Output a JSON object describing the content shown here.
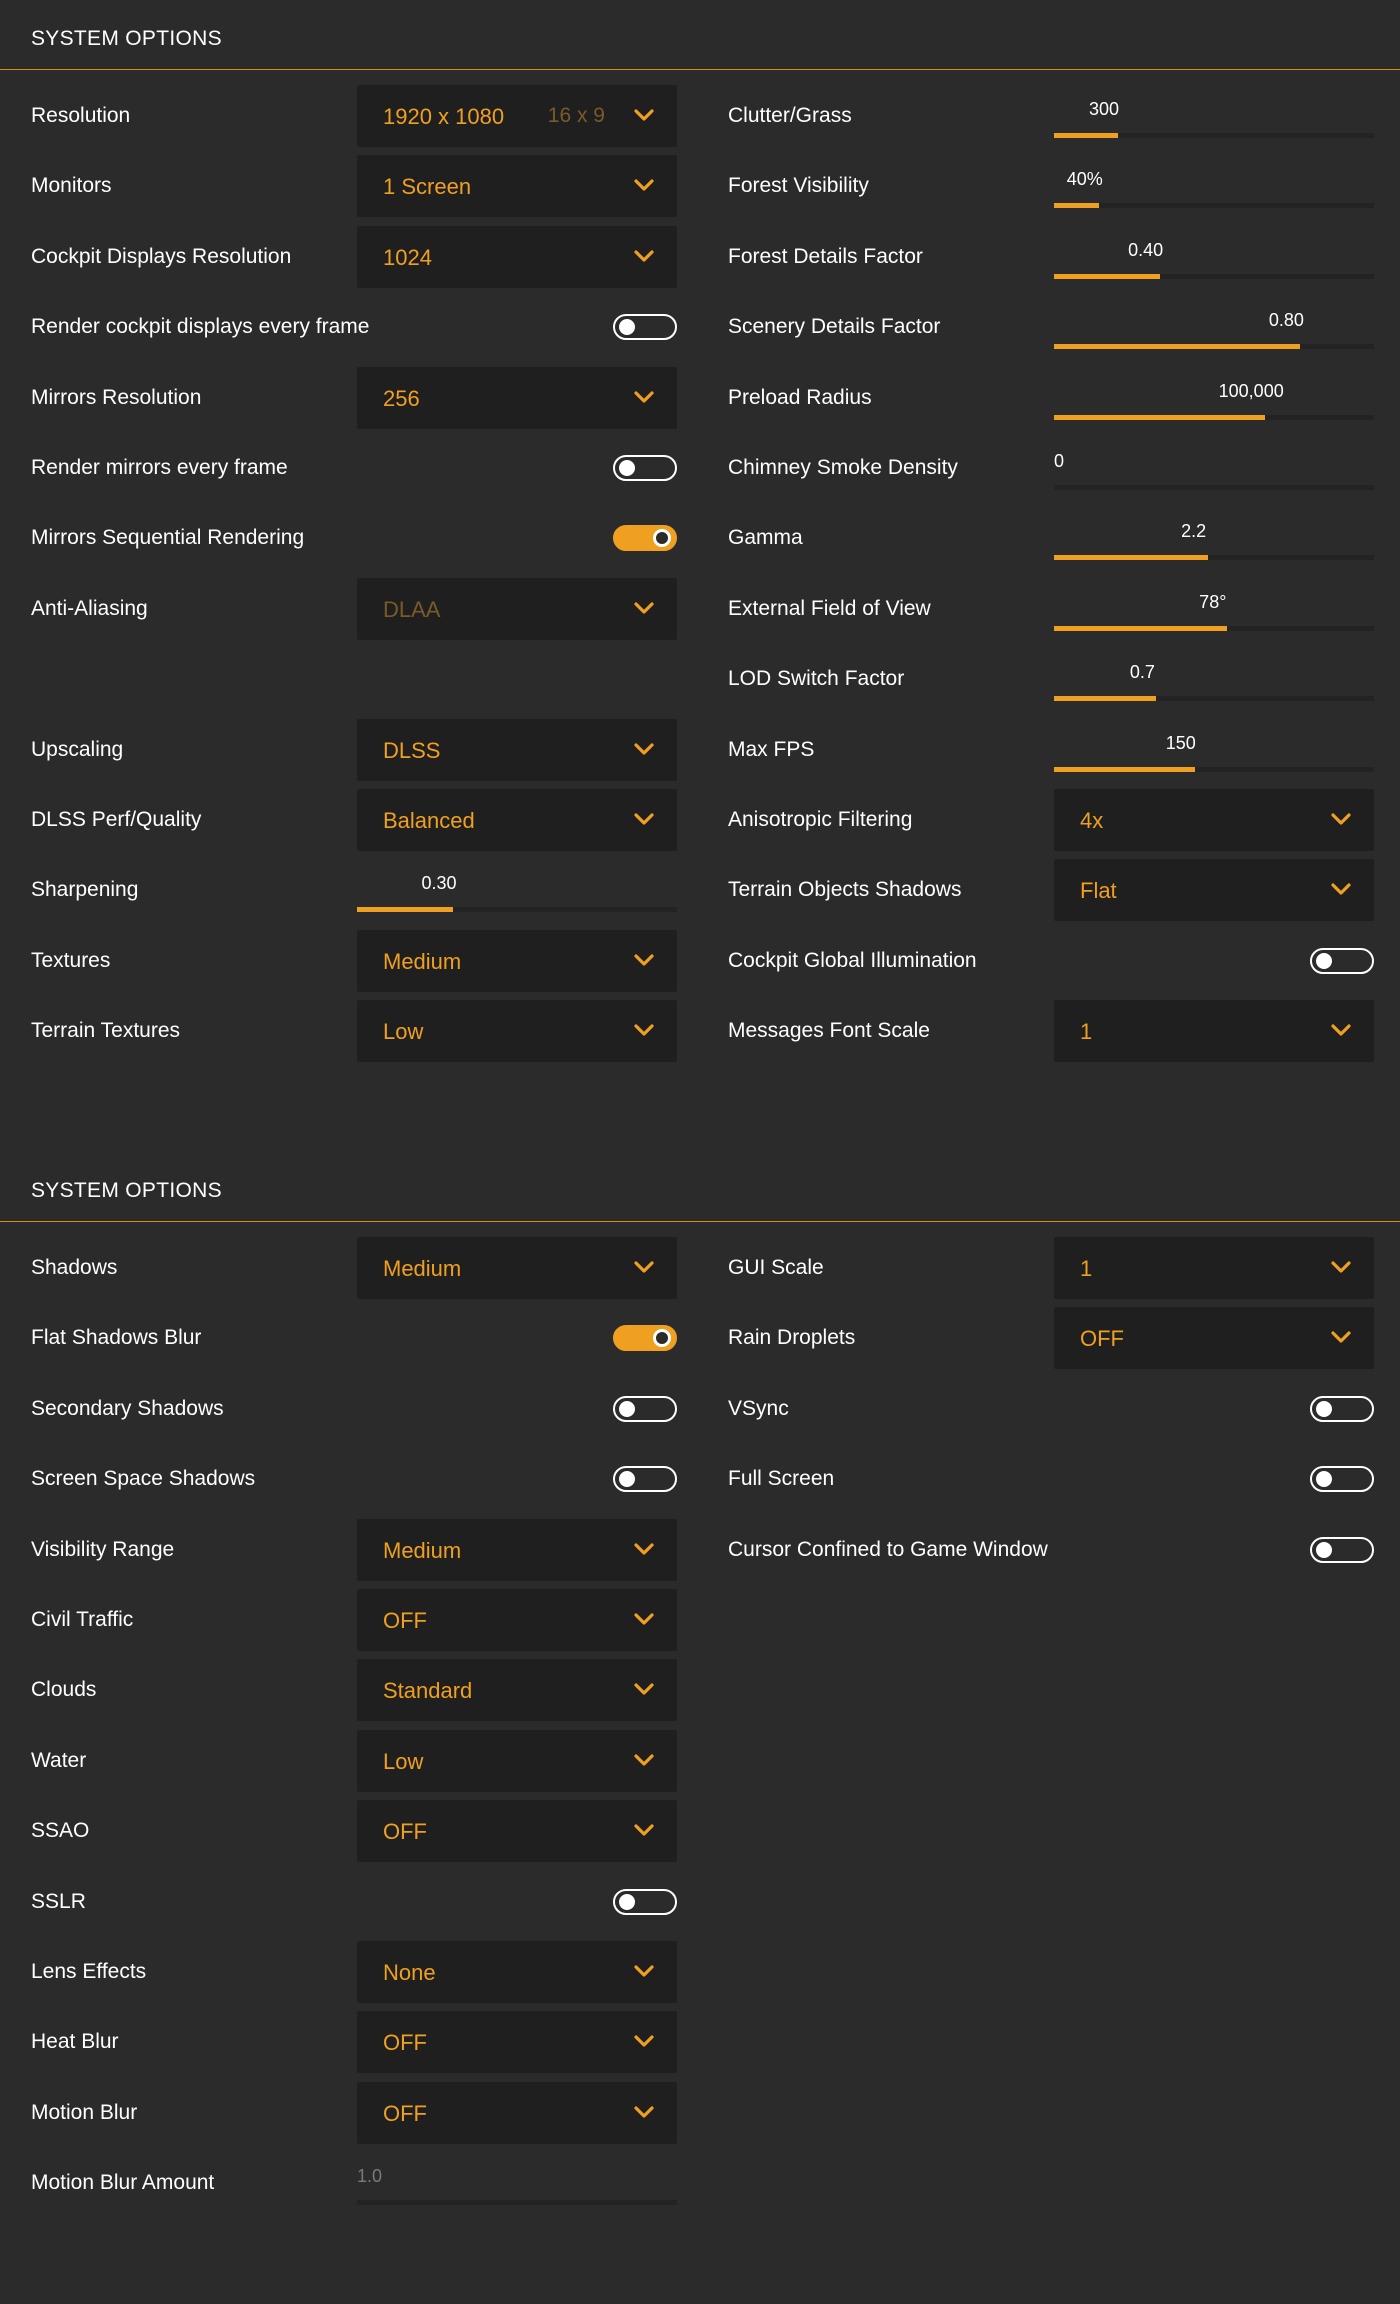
{
  "accent_color": "#f0a020",
  "section1": {
    "title": "SYSTEM OPTIONS",
    "left": [
      {
        "type": "dropdown",
        "label": "Resolution",
        "value": "1920 x 1080",
        "sub": "16 x 9"
      },
      {
        "type": "dropdown",
        "label": "Monitors",
        "value": "1 Screen"
      },
      {
        "type": "dropdown",
        "label": "Cockpit Displays Resolution",
        "value": "1024"
      },
      {
        "type": "toggle",
        "label": "Render cockpit displays every frame",
        "on": false
      },
      {
        "type": "dropdown",
        "label": "Mirrors Resolution",
        "value": "256"
      },
      {
        "type": "toggle",
        "label": "Render mirrors every frame",
        "on": false
      },
      {
        "type": "toggle",
        "label": "Mirrors Sequential Rendering",
        "on": true
      },
      {
        "type": "dropdown",
        "label": "Anti-Aliasing",
        "value": "DLAA",
        "disabled": true
      },
      {
        "type": "empty"
      },
      {
        "type": "dropdown",
        "label": "Upscaling",
        "value": "DLSS"
      },
      {
        "type": "dropdown",
        "label": "DLSS Perf/Quality",
        "value": "Balanced"
      },
      {
        "type": "slider",
        "label": "Sharpening",
        "value": "0.30",
        "fraction": 0.3
      },
      {
        "type": "dropdown",
        "label": "Textures",
        "value": "Medium"
      },
      {
        "type": "dropdown",
        "label": "Terrain Textures",
        "value": "Low"
      }
    ],
    "right": [
      {
        "type": "slider",
        "label": "Clutter/Grass",
        "value": "300",
        "fraction": 0.2
      },
      {
        "type": "slider",
        "label": "Forest Visibility",
        "value": "40%",
        "fraction": 0.14
      },
      {
        "type": "slider",
        "label": "Forest Details Factor",
        "value": "0.40",
        "fraction": 0.33
      },
      {
        "type": "slider",
        "label": "Scenery Details Factor",
        "value": "0.80",
        "fraction": 0.77
      },
      {
        "type": "slider",
        "label": "Preload Radius",
        "value": "100,000",
        "fraction": 0.66
      },
      {
        "type": "slider",
        "label": "Chimney Smoke Density",
        "value": "0",
        "fraction": 0
      },
      {
        "type": "slider",
        "label": "Gamma",
        "value": "2.2",
        "fraction": 0.48
      },
      {
        "type": "slider",
        "label": "External Field of View",
        "value": "78°",
        "fraction": 0.54
      },
      {
        "type": "slider",
        "label": "LOD Switch Factor",
        "value": "0.7",
        "fraction": 0.32
      },
      {
        "type": "slider",
        "label": "Max FPS",
        "value": "150",
        "fraction": 0.44
      },
      {
        "type": "dropdown",
        "label": "Anisotropic Filtering",
        "value": "4x"
      },
      {
        "type": "dropdown",
        "label": "Terrain Objects Shadows",
        "value": "Flat"
      },
      {
        "type": "toggle",
        "label": "Cockpit Global Illumination",
        "on": false
      },
      {
        "type": "dropdown",
        "label": "Messages Font Scale",
        "value": "1"
      }
    ]
  },
  "section2": {
    "title": "SYSTEM OPTIONS",
    "left": [
      {
        "type": "dropdown",
        "label": "Shadows",
        "value": "Medium"
      },
      {
        "type": "toggle",
        "label": "Flat Shadows Blur",
        "on": true
      },
      {
        "type": "toggle",
        "label": "Secondary Shadows",
        "on": false
      },
      {
        "type": "toggle",
        "label": "Screen Space Shadows",
        "on": false
      },
      {
        "type": "dropdown",
        "label": "Visibility Range",
        "value": "Medium"
      },
      {
        "type": "dropdown",
        "label": "Civil Traffic",
        "value": "OFF"
      },
      {
        "type": "dropdown",
        "label": "Clouds",
        "value": "Standard"
      },
      {
        "type": "dropdown",
        "label": "Water",
        "value": "Low"
      },
      {
        "type": "dropdown",
        "label": "SSAO",
        "value": "OFF"
      },
      {
        "type": "toggle",
        "label": "SSLR",
        "on": false
      },
      {
        "type": "dropdown",
        "label": "Lens Effects",
        "value": "None"
      },
      {
        "type": "dropdown",
        "label": "Heat Blur",
        "value": "OFF"
      },
      {
        "type": "dropdown",
        "label": "Motion Blur",
        "value": "OFF"
      },
      {
        "type": "slider",
        "label": "Motion Blur Amount",
        "value": "1.0",
        "fraction": 0,
        "disabled": true
      }
    ],
    "right": [
      {
        "type": "dropdown",
        "label": "GUI Scale",
        "value": "1"
      },
      {
        "type": "dropdown",
        "label": "Rain Droplets",
        "value": "OFF"
      },
      {
        "type": "toggle",
        "label": "VSync",
        "on": false
      },
      {
        "type": "toggle",
        "label": "Full Screen",
        "on": false
      },
      {
        "type": "toggle",
        "label": "Cursor Confined to Game Window",
        "on": false
      }
    ]
  }
}
